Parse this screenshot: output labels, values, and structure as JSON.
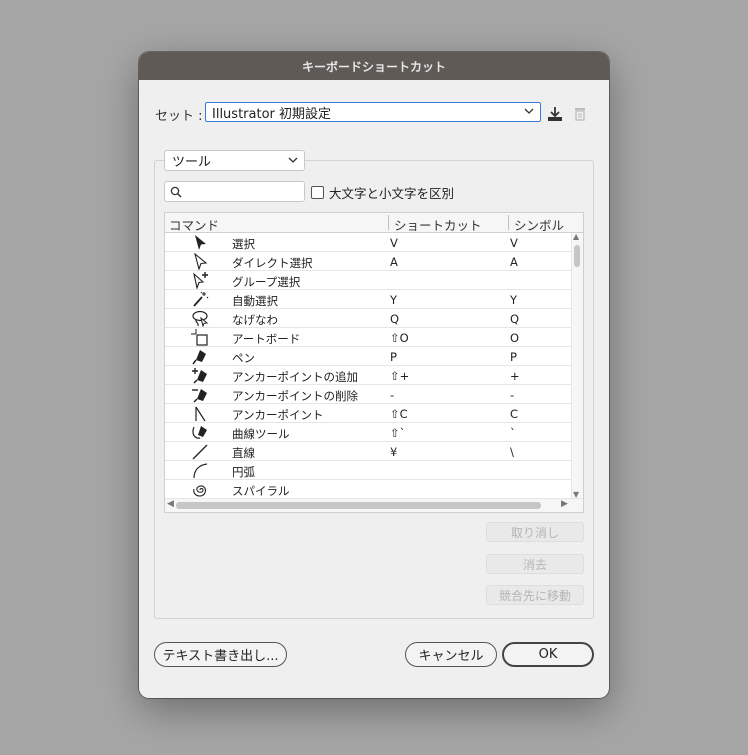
{
  "dialog": {
    "title": "キーボードショートカット",
    "set_label": "セット :",
    "set_value": "Illustrator 初期設定",
    "save_icon": "download-save-icon",
    "delete_icon": "trash-icon",
    "category_value": "ツール",
    "search_placeholder": "",
    "case_label": "大文字と小文字を区別"
  },
  "table": {
    "columns": {
      "command": "コマンド",
      "shortcut": "ショートカット",
      "symbol": "シンボル"
    },
    "rows": [
      {
        "icon": "selection-tool-icon",
        "command": "選択",
        "shortcut": "V",
        "symbol": "V"
      },
      {
        "icon": "direct-selection-tool-icon",
        "command": "ダイレクト選択",
        "shortcut": "A",
        "symbol": "A"
      },
      {
        "icon": "group-selection-tool-icon",
        "command": "グループ選択",
        "shortcut": "",
        "symbol": ""
      },
      {
        "icon": "magic-wand-tool-icon",
        "command": "自動選択",
        "shortcut": "Y",
        "symbol": "Y"
      },
      {
        "icon": "lasso-tool-icon",
        "command": "なげなわ",
        "shortcut": "Q",
        "symbol": "Q"
      },
      {
        "icon": "artboard-tool-icon",
        "command": "アートボード",
        "shortcut": "⇧O",
        "symbol": "O"
      },
      {
        "icon": "pen-tool-icon",
        "command": "ペン",
        "shortcut": "P",
        "symbol": "P"
      },
      {
        "icon": "add-anchor-point-tool-icon",
        "command": "アンカーポイントの追加",
        "shortcut": "⇧+",
        "symbol": "+"
      },
      {
        "icon": "delete-anchor-point-tool-icon",
        "command": "アンカーポイントの削除",
        "shortcut": "-",
        "symbol": "-"
      },
      {
        "icon": "anchor-point-tool-icon",
        "command": "アンカーポイント",
        "shortcut": "⇧C",
        "symbol": "C"
      },
      {
        "icon": "curvature-tool-icon",
        "command": "曲線ツール",
        "shortcut": "⇧`",
        "symbol": "`"
      },
      {
        "icon": "line-segment-tool-icon",
        "command": "直線",
        "shortcut": "¥",
        "symbol": "\\"
      },
      {
        "icon": "arc-tool-icon",
        "command": "円弧",
        "shortcut": "",
        "symbol": ""
      },
      {
        "icon": "spiral-tool-icon",
        "command": "スパイラル",
        "shortcut": "",
        "symbol": ""
      }
    ]
  },
  "side_buttons": {
    "undo": "取り消し",
    "clear": "消去",
    "goto_conflict": "競合先に移動"
  },
  "footer": {
    "export_text": "テキスト書き出し...",
    "cancel": "キャンセル",
    "ok": "OK"
  },
  "colors": {
    "titlebar": "#5f5a55",
    "focus": "#3b7bd8",
    "background": "#efefef"
  }
}
